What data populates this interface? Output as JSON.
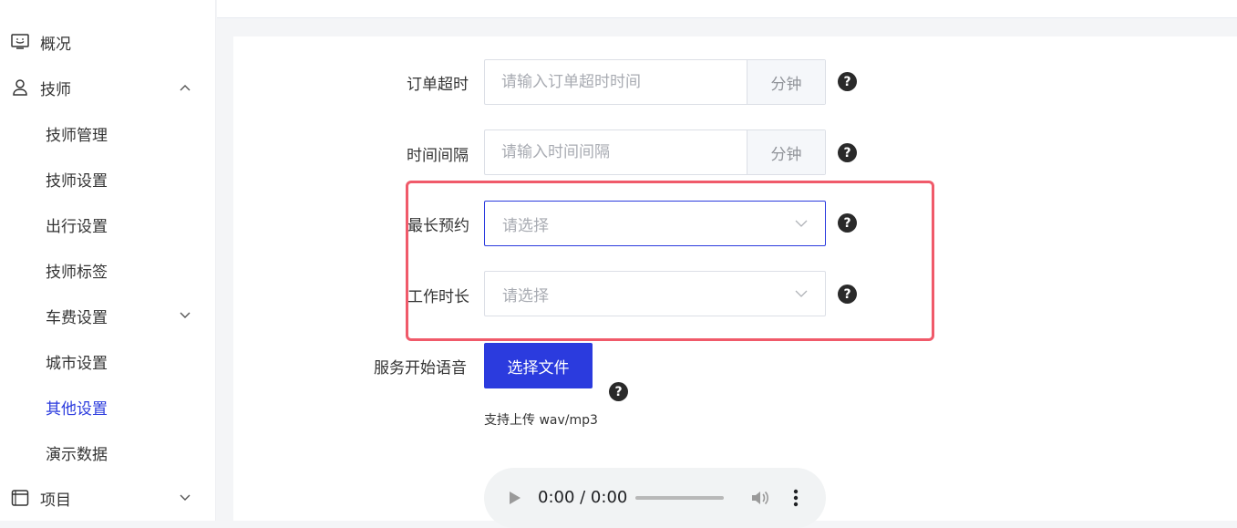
{
  "sidebar": {
    "items": [
      {
        "label": "概况",
        "icon": "monitor-icon"
      },
      {
        "label": "技师",
        "icon": "user-icon",
        "expanded": true
      },
      {
        "label": "技师管理"
      },
      {
        "label": "技师设置"
      },
      {
        "label": "出行设置"
      },
      {
        "label": "技师标签"
      },
      {
        "label": "车费设置"
      },
      {
        "label": "城市设置"
      },
      {
        "label": "其他设置",
        "active": true
      },
      {
        "label": "演示数据"
      },
      {
        "label": "项目",
        "icon": "window-icon"
      }
    ]
  },
  "form": {
    "order_timeout": {
      "label": "订单超时",
      "placeholder": "请输入订单超时时间",
      "value": "",
      "unit": "分钟"
    },
    "time_interval": {
      "label": "时间间隔",
      "placeholder": "请输入时间间隔",
      "value": "",
      "unit": "分钟"
    },
    "max_booking": {
      "label": "最长预约",
      "placeholder": "请选择"
    },
    "work_hours": {
      "label": "工作时长",
      "placeholder": "请选择"
    },
    "service_voice": {
      "label": "服务开始语音",
      "button": "选择文件",
      "tip": "支持上传 wav/mp3"
    },
    "help_symbol": "?"
  },
  "audio": {
    "time": "0:00 / 0:00"
  },
  "colors": {
    "primary": "#2b3bde",
    "highlight": "#f05a6a"
  }
}
